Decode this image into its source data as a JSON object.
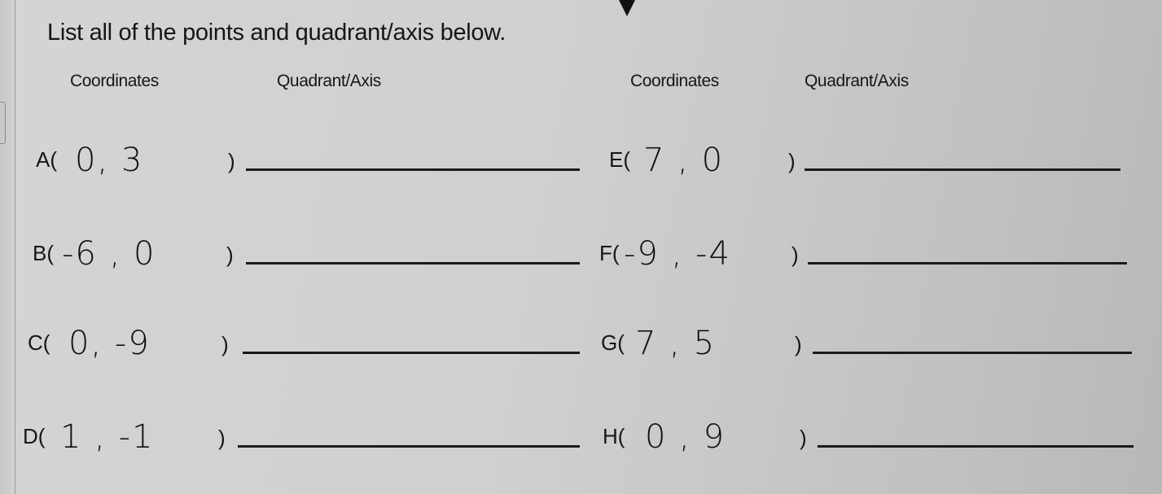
{
  "instructions": "List all of the points and quadrant/axis below.",
  "headers": {
    "left_coordinates": "Coordinates",
    "left_quadrant": "Quadrant/Axis",
    "right_coordinates": "Coordinates",
    "right_quadrant": "Quadrant/Axis"
  },
  "points_left": [
    {
      "label": "A(",
      "x": "0",
      "y": "3",
      "close": ")",
      "answer": ""
    },
    {
      "label": "B(",
      "x": "-6",
      "y": "0",
      "close": ")",
      "answer": ""
    },
    {
      "label": "C(",
      "x": "0",
      "y": "-9",
      "close": ")",
      "answer": ""
    },
    {
      "label": "D(",
      "x": "1",
      "y": "-1",
      "close": ")",
      "answer": ""
    }
  ],
  "points_right": [
    {
      "label": "E(",
      "x": "7",
      "y": "0",
      "close": ")",
      "answer": ""
    },
    {
      "label": "F(",
      "x": "-9",
      "y": "-4",
      "close": ")",
      "answer": ""
    },
    {
      "label": "G(",
      "x": "7",
      "y": "5",
      "close": ")",
      "answer": ""
    },
    {
      "label": "H(",
      "x": "0",
      "y": "9",
      "close": ")",
      "answer": ""
    }
  ]
}
